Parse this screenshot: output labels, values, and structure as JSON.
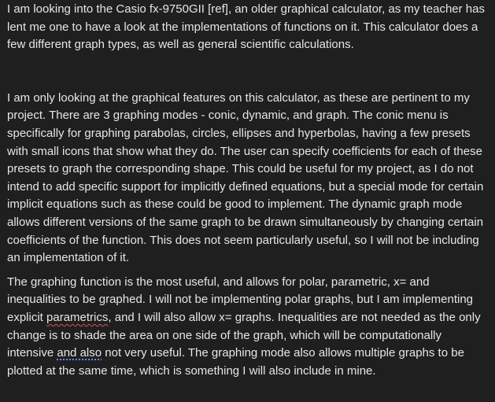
{
  "paragraphs": [
    {
      "pre": "I am looking into the Casio fx-9750GII [ref], an older graphical calculator, as my teacher has lent me one to have a look at the implementations of functions on it. This calculator does a few different graph types, as well as general scientific calculations."
    },
    {
      "pre": "I am only looking at the graphical features on this calculator, as these are pertinent to my project. There are 3 graphing modes - conic, dynamic, and graph. The conic menu is specifically for graphing parabolas, circles, ellipses and hyperbolas, having a few presets with small icons that show what they do. The user can specify coefficients for each of these presets to graph the corresponding shape. This could be useful for my project, as I do not intend to add specific support for implicitly defined equations, but a special mode for certain implicit equations such as these could be good to implement. The dynamic graph mode allows different versions of the same graph to be drawn simultaneously by changing certain coefficients of the function. This does not seem particularly useful, so I will not be including an implementation of it."
    },
    {
      "pre": "The graphing function is the most useful, and allows for polar, parametric, x= and inequalities to be graphed. I will not be implementing polar graphs, but I am implementing explicit ",
      "spell": "parametrics",
      "mid": ", and I will also allow x= graphs. Inequalities are not needed as the only change is to shade the area on one side of the graph, which will be computationally intensive ",
      "grammar": "and also",
      "post": " not very useful. The graphing mode also allows multiple graphs to be plotted at the same time, which is something I will also include in mine."
    }
  ]
}
